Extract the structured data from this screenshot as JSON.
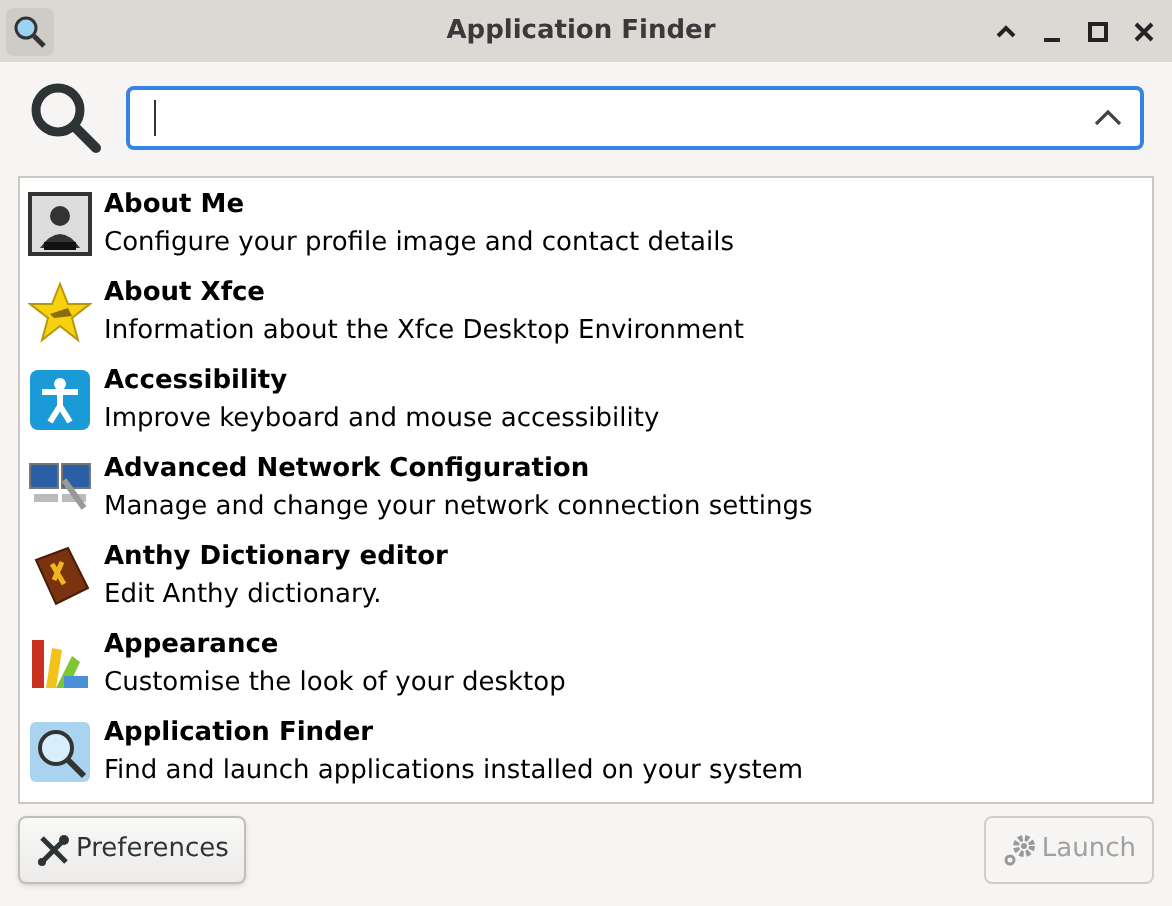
{
  "window": {
    "title": "Application Finder"
  },
  "items": [
    {
      "kind": "person",
      "name": "About Me",
      "description": "Configure your profile image and contact details"
    },
    {
      "kind": "star",
      "name": "About Xfce",
      "description": "Information about the Xfce Desktop Environment"
    },
    {
      "kind": "accessibility",
      "name": "Accessibility",
      "description": "Improve keyboard and mouse accessibility"
    },
    {
      "kind": "network",
      "name": "Advanced Network Configuration",
      "description": "Manage and change your network connection settings"
    },
    {
      "kind": "book",
      "name": "Anthy Dictionary editor",
      "description": "Edit Anthy dictionary."
    },
    {
      "kind": "palette",
      "name": "Appearance",
      "description": "Customise the look of your desktop"
    },
    {
      "kind": "finder",
      "name": "Application Finder",
      "description": "Find and launch applications installed on your system"
    }
  ],
  "buttons": {
    "preferences": {
      "label": "Preferences",
      "disabled": false
    },
    "launch": {
      "label": "Launch",
      "disabled": true
    }
  }
}
